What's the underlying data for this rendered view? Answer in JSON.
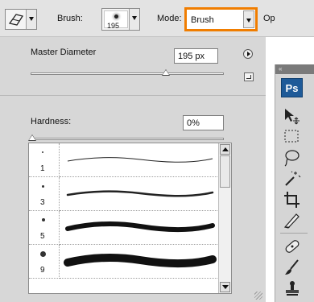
{
  "options_bar": {
    "brush_label": "Brush:",
    "brush_size": "195",
    "mode_label": "Mode:",
    "mode_value": "Brush",
    "opacity_label_clipped": "Op"
  },
  "brushes_panel": {
    "master_diameter_label": "Master Diameter",
    "master_diameter_value": "195 px",
    "master_diameter_fraction": 0.7,
    "hardness_label": "Hardness:",
    "hardness_value": "0%",
    "hardness_fraction": 0,
    "brushes": [
      {
        "size": "1"
      },
      {
        "size": "3"
      },
      {
        "size": "5"
      },
      {
        "size": "9"
      }
    ]
  },
  "tools_panel": {
    "logo_text": "Ps",
    "tools": [
      "move-tool",
      "rectangular-marquee-tool",
      "lasso-tool",
      "magic-wand-tool",
      "crop-tool",
      "slice-tool",
      "healing-brush-tool",
      "brush-tool",
      "clone-stamp-tool"
    ]
  },
  "colors": {
    "highlight": "#f07d00",
    "panel": "#d7d7d7",
    "ps_logo": "#1e5a98"
  }
}
